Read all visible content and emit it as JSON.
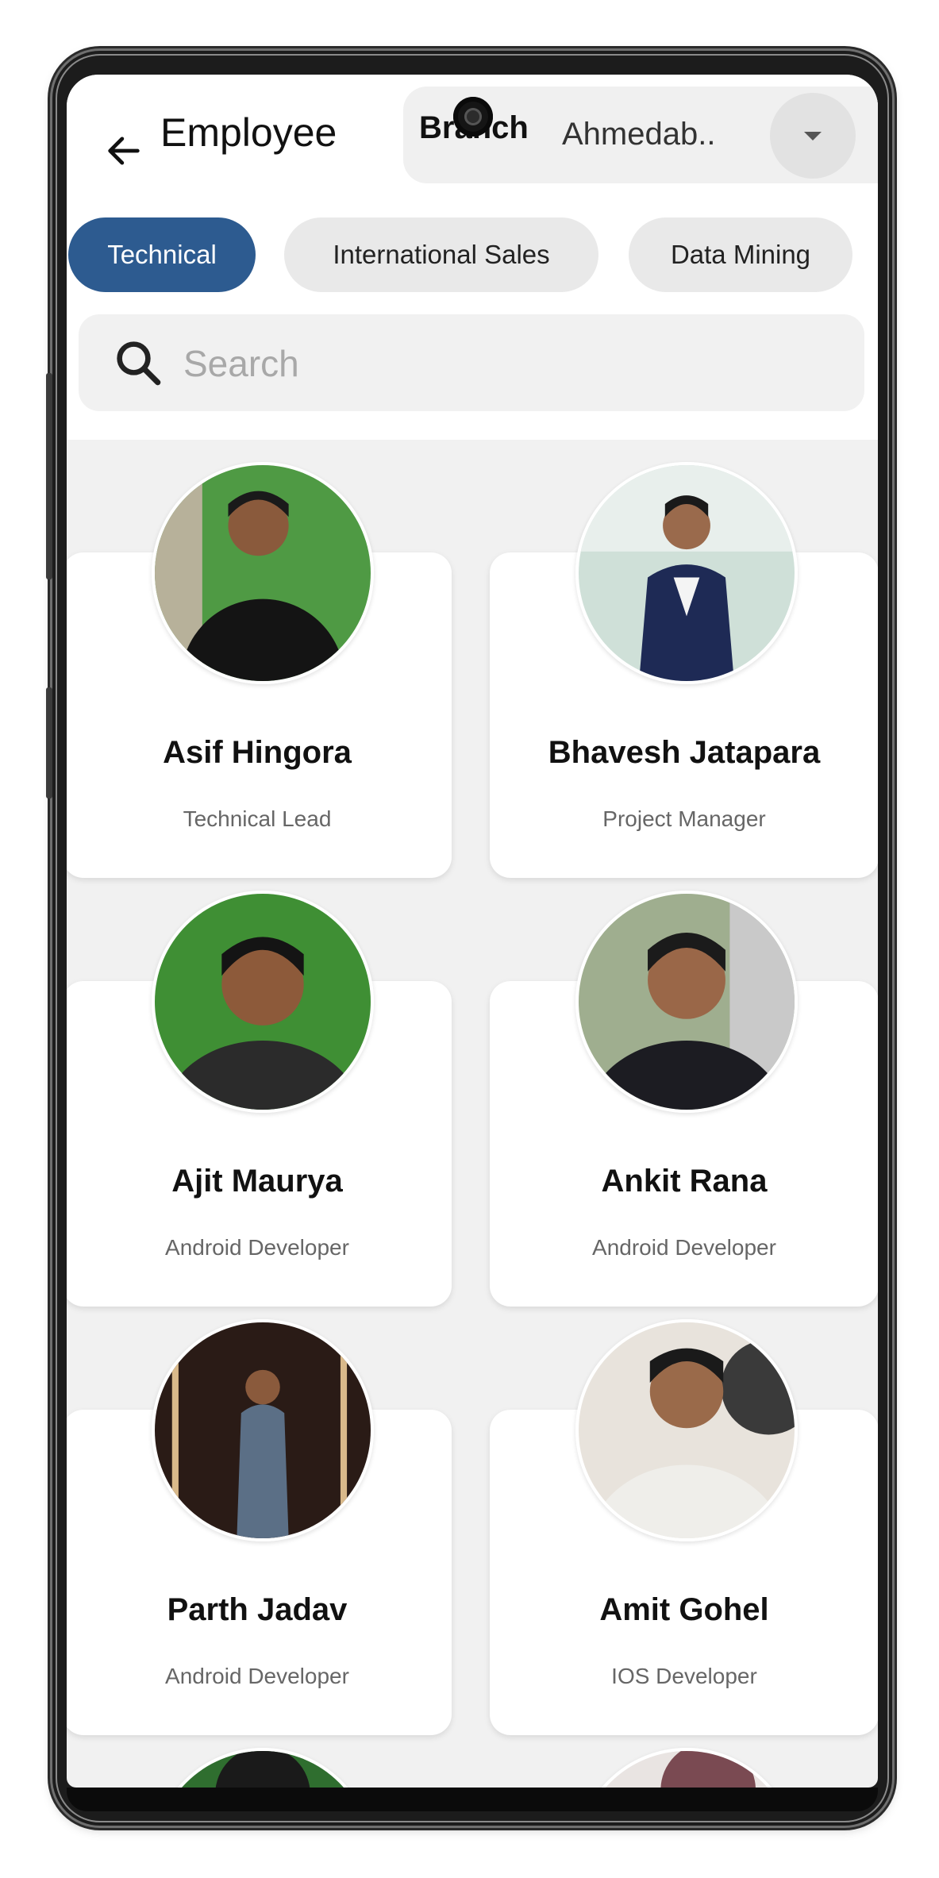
{
  "header": {
    "title": "Employee",
    "branch_label": "Branch",
    "branch_value": "Ahmedab.."
  },
  "departments": [
    {
      "label": "Technical",
      "active": true
    },
    {
      "label": "International Sales",
      "active": false
    },
    {
      "label": "Data Mining",
      "active": false
    }
  ],
  "search": {
    "placeholder": "Search",
    "value": ""
  },
  "employees": [
    {
      "name": "Asif Hingora",
      "role": "Technical Lead"
    },
    {
      "name": "Bhavesh Jatapara",
      "role": "Project Manager"
    },
    {
      "name": "Ajit Maurya",
      "role": "Android Developer"
    },
    {
      "name": "Ankit Rana",
      "role": "Android Developer"
    },
    {
      "name": "Parth Jadav",
      "role": "Android Developer"
    },
    {
      "name": "Amit Gohel",
      "role": "IOS Developer"
    }
  ],
  "colors": {
    "accent": "#2d5b90",
    "chip_bg": "#e9e9e9",
    "screen_bg": "#f1f1f1"
  }
}
